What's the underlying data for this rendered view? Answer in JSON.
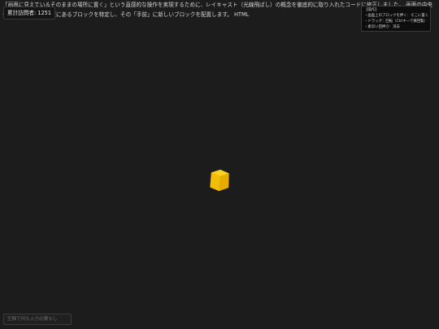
{
  "description": "「画面に見えているそのままの場所に置く」という直感的な操作を実現するために、レイキャスト（光線飛ばし）の概念を徹底的に取り入れたコードに修正しました。 画面の中央や任意のクリック位置にあるブロックを特定し、その「手前」に新しいブロックを配置します。 HTML",
  "visit_counter": {
    "label": "累計訪問者",
    "separator": ": ",
    "value": "1251"
  },
  "help": {
    "title": "【操作】",
    "items": [
      "・画面上のブロックを押く：そこに置く",
      "・ドラッグ：回転（Ctrlキーで横回覧）",
      "・素早い回押さ：消去"
    ]
  },
  "chat": {
    "placeholder": "空欄で何も入力必要なし"
  },
  "colors": {
    "background": "#1c1c1c",
    "block_top": "#ffd21f",
    "block_left": "#f2bd05",
    "block_right": "#e6ad00"
  }
}
